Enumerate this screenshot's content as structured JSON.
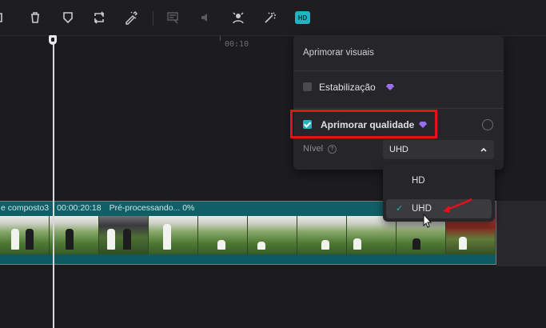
{
  "toolbar": {
    "icons": [
      "split-icon",
      "delete-icon",
      "shield-icon",
      "loop-icon",
      "pen-wand-icon",
      "separator",
      "caption-icon",
      "audio-icon",
      "person-spotlight-icon",
      "magic-wand-icon",
      "hd-icon"
    ],
    "hd_label": "HD"
  },
  "timeline": {
    "ruler_label": "00:10",
    "clip": {
      "name": "e composto3",
      "duration": "00:00:20:18",
      "status": "Pré-processando... 0%"
    }
  },
  "panel": {
    "title": "Aprimorar visuais",
    "stabilize": {
      "label": "Estabilização",
      "checked": false
    },
    "enhance": {
      "label": "Aprimorar qualidade",
      "checked": true
    },
    "level": {
      "label": "Nível",
      "value": "UHD"
    },
    "accent_color": "#1fb4c4",
    "premium_gem_color": "#9b6cf0",
    "highlight_color": "#e2121b"
  },
  "dropdown": {
    "options": [
      {
        "label": "HD",
        "selected": false
      },
      {
        "label": "UHD",
        "selected": true
      }
    ]
  }
}
